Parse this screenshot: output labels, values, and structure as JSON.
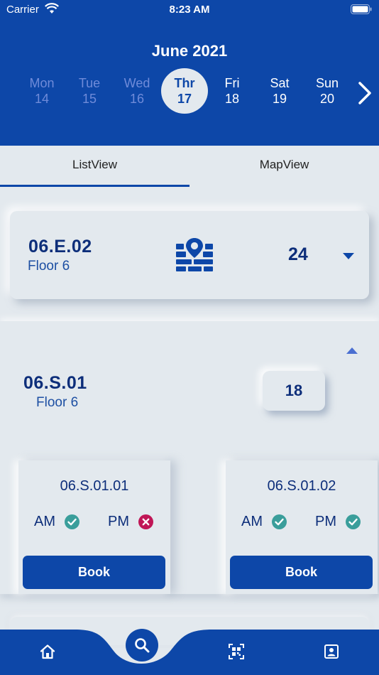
{
  "status_bar": {
    "carrier": "Carrier",
    "time": "8:23 AM"
  },
  "calendar": {
    "month": "June 2021",
    "days": [
      {
        "name": "Mon",
        "date": "14",
        "state": "past"
      },
      {
        "name": "Tue",
        "date": "15",
        "state": "past"
      },
      {
        "name": "Wed",
        "date": "16",
        "state": "past"
      },
      {
        "name": "Thr",
        "date": "17",
        "state": "selected"
      },
      {
        "name": "Fri",
        "date": "18",
        "state": "future"
      },
      {
        "name": "Sat",
        "date": "19",
        "state": "future"
      },
      {
        "name": "Sun",
        "date": "20",
        "state": "future"
      }
    ]
  },
  "tabs": [
    {
      "label": "ListView",
      "active": true
    },
    {
      "label": "MapView",
      "active": false
    }
  ],
  "rooms": [
    {
      "code": "06.E.02",
      "floor": "Floor 6",
      "count": "24",
      "expanded": false,
      "icon": "floor-plan-icon"
    },
    {
      "code": "06.S.01",
      "floor": "Floor 6",
      "count": "18",
      "expanded": true
    }
  ],
  "desks": [
    {
      "name": "06.S.01.01",
      "am_label": "AM",
      "am_available": true,
      "pm_label": "PM",
      "pm_available": false,
      "book_label": "Book"
    },
    {
      "name": "06.S.01.02",
      "am_label": "AM",
      "am_available": true,
      "pm_label": "PM",
      "pm_available": true,
      "book_label": "Book"
    }
  ],
  "colors": {
    "primary": "#0d47a8",
    "available": "#3a9e9b",
    "unavailable": "#c01656",
    "background": "#e3e9ee"
  },
  "bottom_nav": {
    "items": [
      "home-icon",
      "search-icon",
      "qr-code-icon",
      "profile-icon"
    ]
  }
}
